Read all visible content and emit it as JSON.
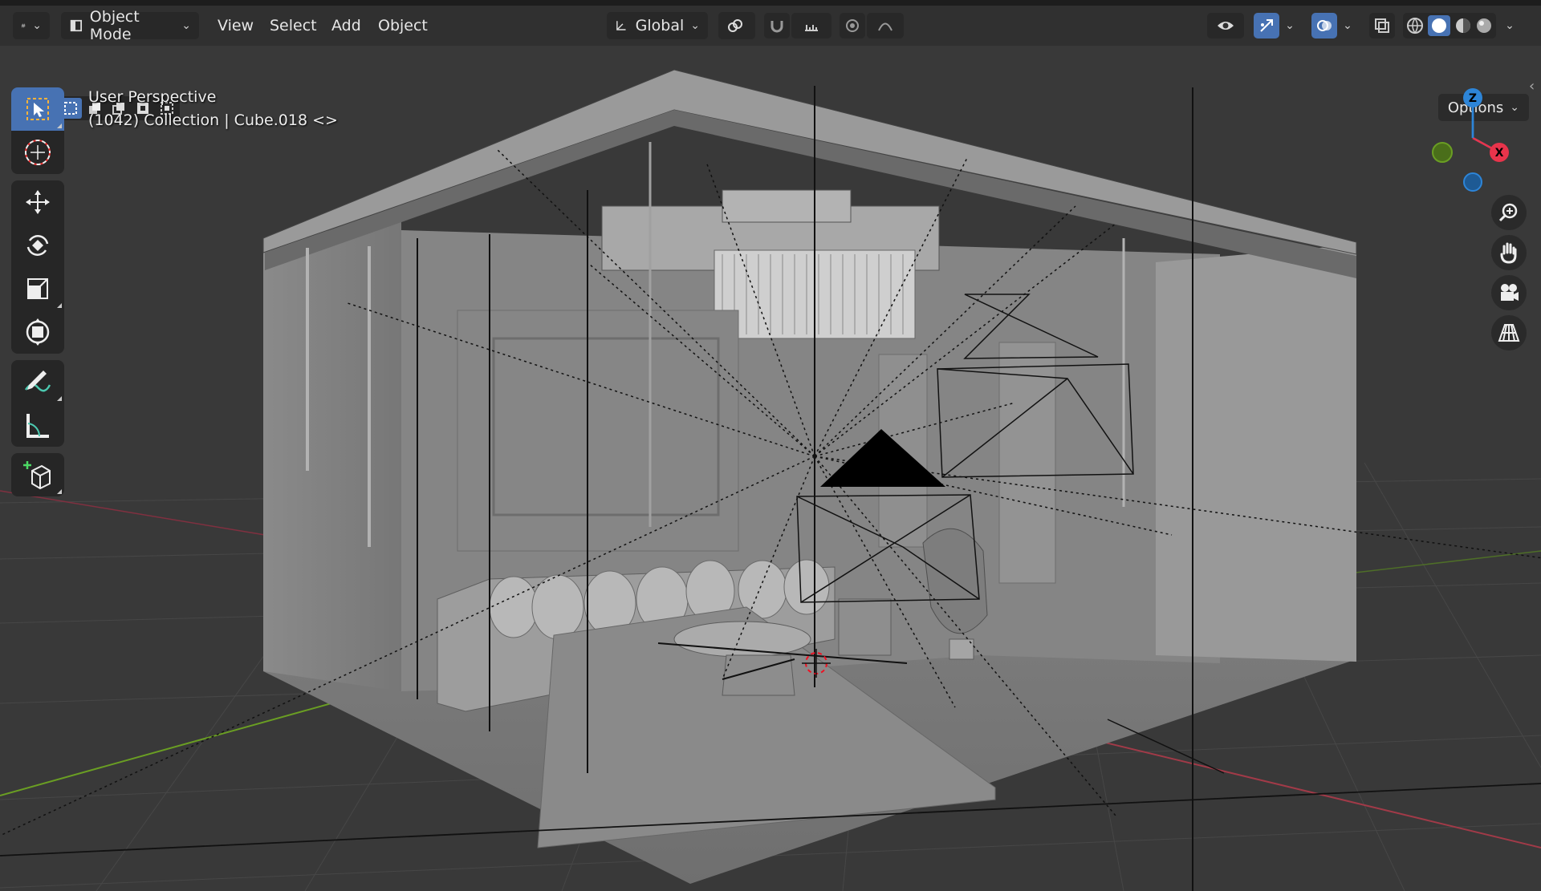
{
  "header": {
    "editor_icon": "viewport-editor-icon",
    "mode_label": "Object Mode",
    "menus": [
      "View",
      "Select",
      "Add",
      "Object"
    ],
    "orientation_label": "Global",
    "options_label": "Options"
  },
  "viewport": {
    "perspective_label": "User Perspective",
    "collection_label": "(1042) Collection | Cube.018 <>"
  },
  "gizmo": {
    "axes": [
      "Z",
      "X",
      "Y"
    ],
    "colors": {
      "x": "#e8344b",
      "y": "#6a9e23",
      "z": "#2d85d8"
    }
  },
  "tools": [
    {
      "name": "select-box-icon",
      "active": true
    },
    {
      "name": "cursor-icon"
    },
    {
      "name": "move-icon"
    },
    {
      "name": "rotate-icon"
    },
    {
      "name": "scale-icon"
    },
    {
      "name": "transform-icon"
    },
    {
      "name": "annotate-icon"
    },
    {
      "name": "measure-icon"
    },
    {
      "name": "add-cube-icon"
    }
  ],
  "nav": [
    "zoom-icon",
    "hand-pan-icon",
    "camera-icon",
    "perspective-grid-icon"
  ],
  "theme": {
    "accent": "#4772b3",
    "header_bg": "#303030",
    "viewport_bg": "#393939"
  }
}
